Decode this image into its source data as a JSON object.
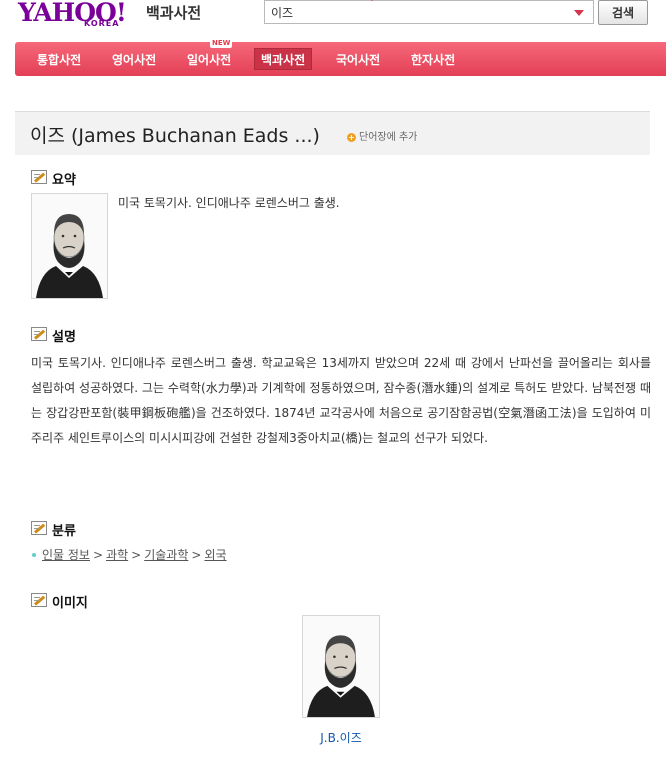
{
  "header": {
    "logo_text": "YAHOO!",
    "logo_sub": "KOREA",
    "brand_title": "백과사전",
    "search": {
      "value": "이즈",
      "placeholder": ""
    },
    "search_button": "검색"
  },
  "nav": {
    "new_badge": "NEW",
    "items": [
      {
        "label": "통합사전"
      },
      {
        "label": "영어사전"
      },
      {
        "label": "일어사전"
      },
      {
        "label": "백과사전"
      },
      {
        "label": "국어사전"
      },
      {
        "label": "한자사전"
      }
    ],
    "active_index": 3
  },
  "article": {
    "title": "이즈 (James Buchanan Eads ...)",
    "add_wordbook": "단어장에 추가",
    "add_icon": "plus-icon",
    "summary": {
      "heading": "요약",
      "text": "미국 토목기사. 인디애나주 로렌스버그 출생."
    },
    "description": {
      "heading": "설명",
      "text": "미국 토목기사. 인디애나주 로렌스버그 출생. 학교교육은 13세까지 받았으며 22세 때 강에서 난파선을 끌어올리는 회사를 설립하여 성공하였다. 그는 수력학(水力學)과 기계학에 정통하였으며, 잠수종(潛水鍾)의 설계로 특허도 받았다. 남북전쟁 때는 장갑강판포함(裝甲鋼板砲艦)을 건조하였다. 1874년 교각공사에 처음으로 공기잠함공법(空氣潛函工法)을 도입하여 미주리주 세인트루이스의 미시시피강에 건설한 강철제3중아치교(橋)는 철교의 선구가 되었다."
    },
    "category": {
      "heading": "분류",
      "crumbs": [
        "인물 정보",
        "과학",
        "기술과학",
        "외국"
      ],
      "separator": ">"
    },
    "images": {
      "heading": "이미지",
      "caption": "J.B.이즈"
    }
  },
  "colors": {
    "nav_bg": "#e8465b",
    "nav_active": "#c93247",
    "logo": "#7b0099",
    "link_blue": "#1558b0"
  }
}
